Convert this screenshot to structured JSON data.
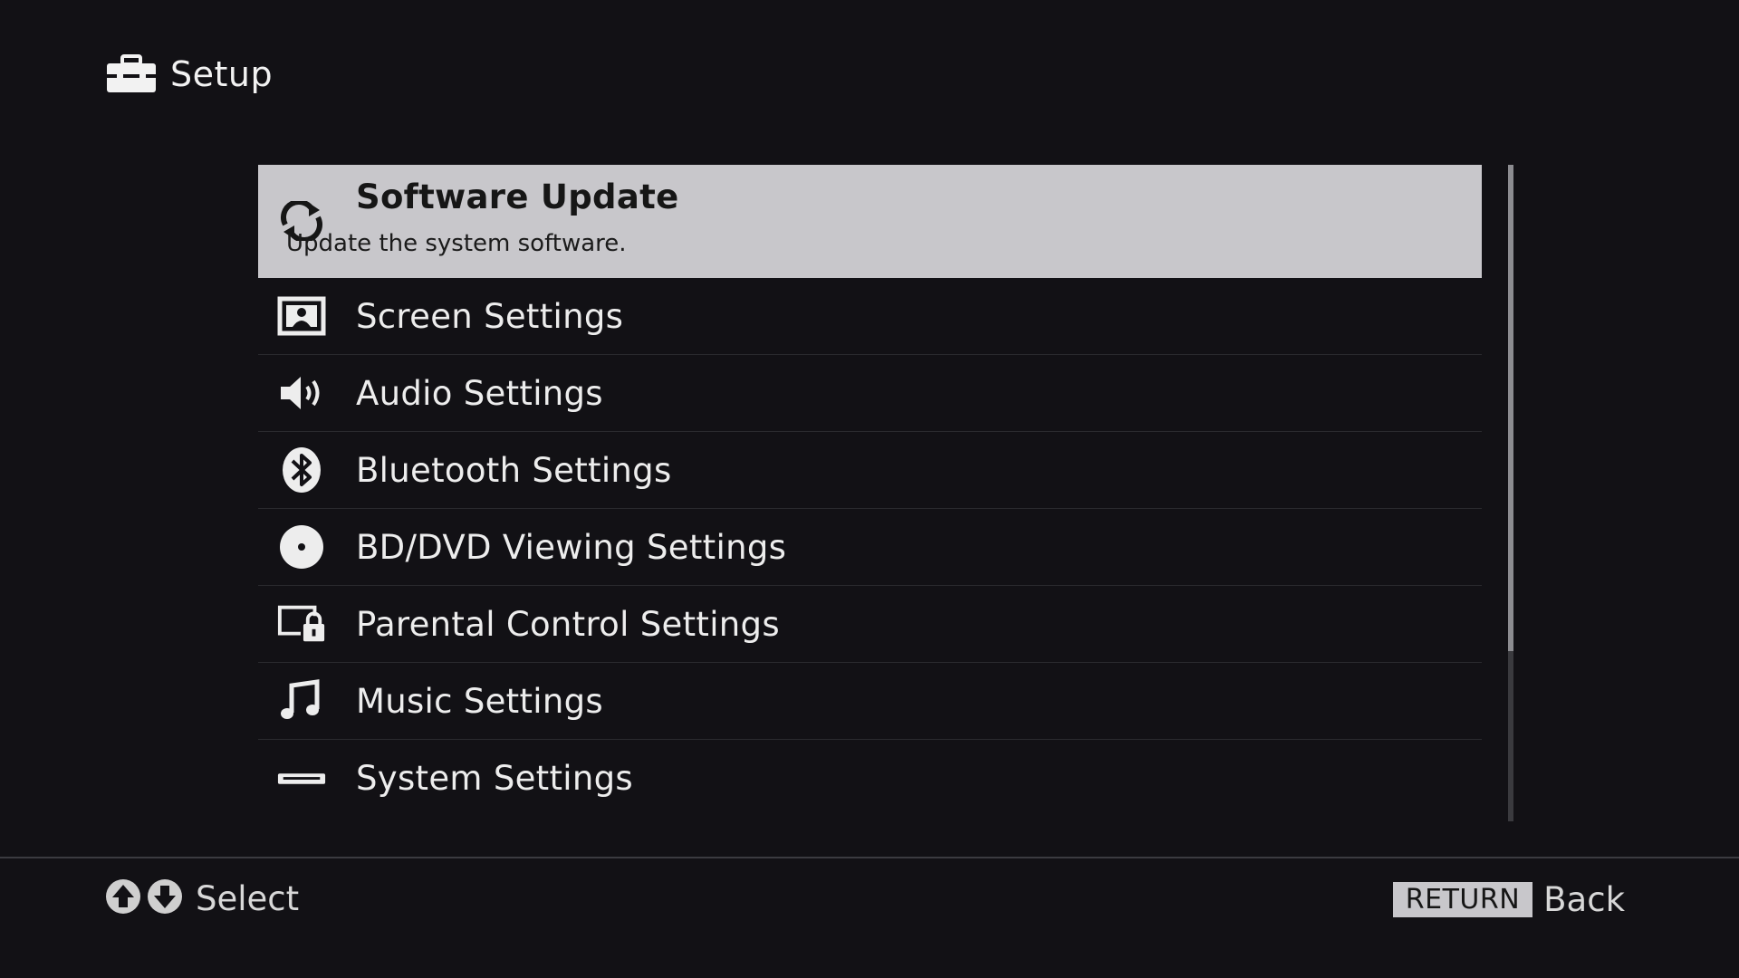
{
  "header": {
    "title": "Setup",
    "icon": "toolbox-icon"
  },
  "menu": {
    "items": [
      {
        "label": "Software Update",
        "description": "Update the system software.",
        "icon": "refresh-icon",
        "selected": true
      },
      {
        "label": "Screen Settings",
        "icon": "screen-icon"
      },
      {
        "label": "Audio Settings",
        "icon": "speaker-icon"
      },
      {
        "label": "Bluetooth Settings",
        "icon": "bluetooth-icon"
      },
      {
        "label": "BD/DVD Viewing Settings",
        "icon": "disc-icon"
      },
      {
        "label": "Parental Control Settings",
        "icon": "screen-lock-icon"
      },
      {
        "label": "Music Settings",
        "icon": "music-note-icon"
      },
      {
        "label": "System Settings",
        "icon": "device-icon"
      }
    ]
  },
  "scrollbar": {
    "visible_fraction": 0.74,
    "position_fraction": 0.0
  },
  "footer": {
    "select_hint": "Select",
    "return_key": "RETURN",
    "back_hint": "Back"
  },
  "colors": {
    "background": "#121115",
    "highlight": "#c8c7cb",
    "text": "#ececec"
  }
}
